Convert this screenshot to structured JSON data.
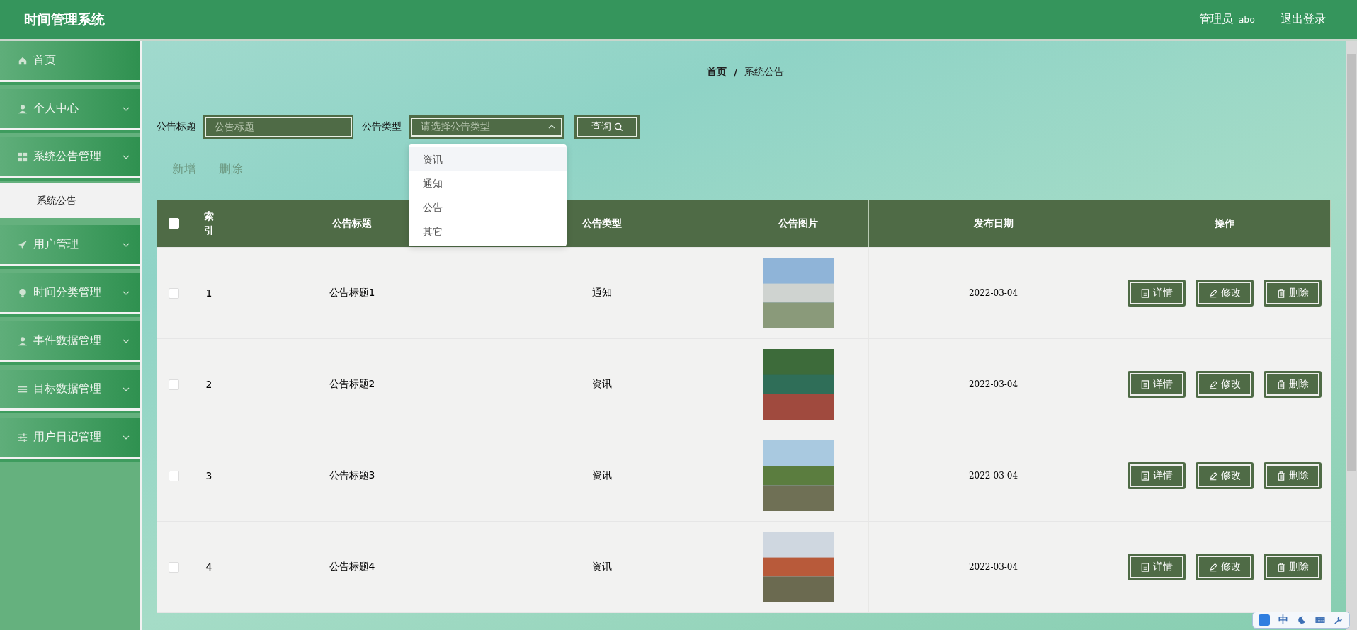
{
  "header": {
    "title": "时间管理系统",
    "user_role": "管理员",
    "user_name": "abo",
    "logout": "退出登录"
  },
  "sidebar": {
    "items": [
      {
        "label": "首页",
        "has_arrow": false,
        "expanded": false
      },
      {
        "label": "个人中心",
        "has_arrow": true,
        "expanded": false
      },
      {
        "label": "系统公告管理",
        "has_arrow": true,
        "expanded": true,
        "children": [
          {
            "label": "系统公告",
            "selected": true
          }
        ]
      },
      {
        "label": "用户管理",
        "has_arrow": true,
        "expanded": false
      },
      {
        "label": "时间分类管理",
        "has_arrow": true,
        "expanded": false
      },
      {
        "label": "事件数据管理",
        "has_arrow": true,
        "expanded": false
      },
      {
        "label": "目标数据管理",
        "has_arrow": true,
        "expanded": false
      },
      {
        "label": "用户日记管理",
        "has_arrow": true,
        "expanded": false
      }
    ]
  },
  "breadcrumb": [
    "首页",
    "系统公告"
  ],
  "breadcrumb_separator": "/",
  "search": {
    "title_label": "公告标题",
    "title_placeholder": "公告标题",
    "type_label": "公告类型",
    "type_placeholder": "请选择公告类型",
    "button": "查询",
    "dropdown": {
      "open": true,
      "options": [
        {
          "label": "资讯",
          "highlighted": true
        },
        {
          "label": "通知",
          "highlighted": false
        },
        {
          "label": "公告",
          "highlighted": false
        },
        {
          "label": "其它",
          "highlighted": false
        }
      ]
    }
  },
  "actions": [
    "新增",
    "删除"
  ],
  "table": {
    "columns": [
      "索引",
      "公告标题",
      "公告类型",
      "公告图片",
      "发布日期",
      "操作"
    ],
    "header_checked": false,
    "rows": [
      {
        "checked": false,
        "index": "1",
        "title": "公告标题1",
        "type": "通知",
        "date": "2022-03-04",
        "buttons": [
          "详情",
          "修改",
          "删除"
        ]
      },
      {
        "checked": false,
        "index": "2",
        "title": "公告标题2",
        "type": "资讯",
        "date": "2022-03-04",
        "buttons": [
          "详情",
          "修改",
          "删除"
        ]
      },
      {
        "checked": false,
        "index": "3",
        "title": "公告标题3",
        "type": "资讯",
        "date": "2022-03-04",
        "buttons": [
          "详情",
          "修改",
          "删除"
        ]
      },
      {
        "checked": false,
        "index": "4",
        "title": "公告标题4",
        "type": "资讯",
        "date": "2022-03-04",
        "buttons": [
          "详情",
          "修改",
          "删除"
        ]
      }
    ]
  },
  "ime": {
    "mode": "中"
  }
}
